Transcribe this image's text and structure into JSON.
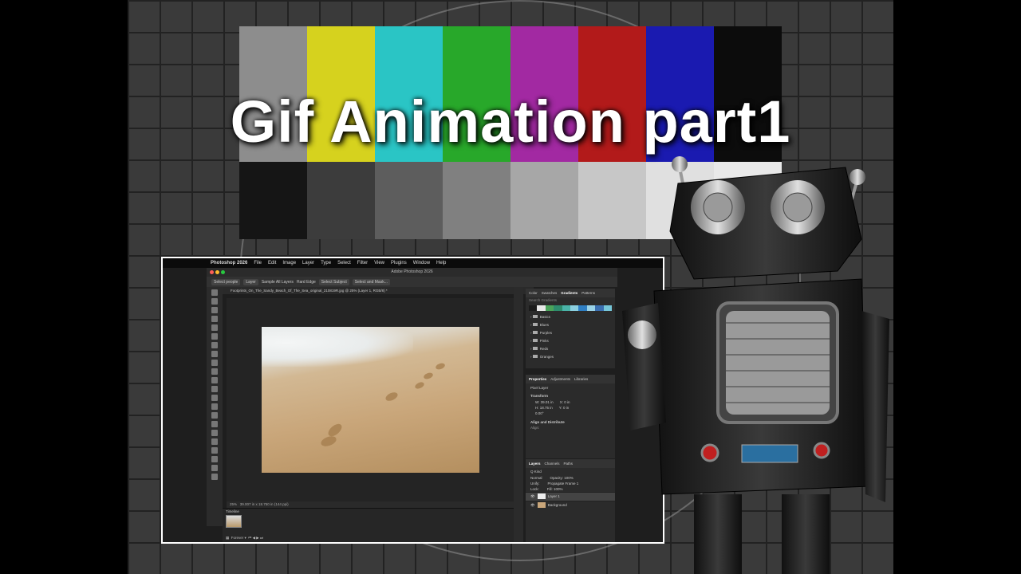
{
  "headline": "Gif Animation part1",
  "app": {
    "menubar": [
      "Photoshop 2026",
      "File",
      "Edit",
      "Image",
      "Layer",
      "Type",
      "Select",
      "Filter",
      "View",
      "Plugins",
      "Window",
      "Help"
    ],
    "window_title": "Adobe Photoshop 2026",
    "options": {
      "select_people": "Select people",
      "layer_select": "Layer",
      "sample_all": "Sample All Layers",
      "hard_edge": "Hard Edge",
      "select_subject": "Select Subject",
      "select_mask": "Select and Mask..."
    },
    "document_tab": "Footprints_On_The_Sandy_Beach_Of_The_Sea_original_210819R.jpg @ 25% (Layer 1, RGB/8) *",
    "status": {
      "zoom": "25%",
      "size": "39.007 in x 18.750 in (144 ppi)"
    },
    "timeline": {
      "label": "Timeline",
      "frame_delay": "0 sec.",
      "loop": "Forever"
    },
    "panels": {
      "top_tabs": [
        "Color",
        "Swatches",
        "Gradients",
        "Patterns"
      ],
      "search_placeholder": "Search Gradients",
      "gradient_folders": [
        "Basics",
        "Blues",
        "Purples",
        "Pinks",
        "Reds",
        "Oranges"
      ],
      "properties_tabs": [
        "Properties",
        "Adjustments",
        "Libraries"
      ],
      "pixel_layer": "Pixel Layer",
      "transform_label": "Transform",
      "w_value": "W: 39.01 in",
      "h_value": "H: 18.75 in",
      "x_value": "X: 0 in",
      "y_value": "Y: 0 in",
      "angle": "0.00°",
      "align_label": "Align and Distribute",
      "align_sub": "Align:",
      "layers_tabs": [
        "Layers",
        "Channels",
        "Paths"
      ],
      "kind": "Q Kind",
      "blend_mode": "Normal",
      "opacity": "Opacity: 100%",
      "unify": "Unify:",
      "propagate": "Propagate Frame 1",
      "lock": "Lock:",
      "fill": "Fill: 100%",
      "layers": [
        "Layer 1",
        "Background"
      ]
    }
  },
  "colors": {
    "bars_top": [
      "#8d8d8d",
      "#d6d21e",
      "#2ac5c5",
      "#28a82a",
      "#a229a2",
      "#b21a1a",
      "#1a1ab0",
      "#0c0c0c"
    ],
    "bars_bottom": [
      "#151515",
      "#3c3c3c",
      "#5d5d5d",
      "#808080",
      "#a7a7a7",
      "#c7c7c7",
      "#e0e0e0",
      "#e9e9e9"
    ],
    "gradients": [
      "#1b1b1b",
      "#e8e8e8",
      "#4aa35a",
      "#2e8c6d",
      "#4ab3a8",
      "#8bcfe0",
      "#2f7fc4",
      "#9ad3e8",
      "#3b6fb0",
      "#76c6d8"
    ]
  }
}
